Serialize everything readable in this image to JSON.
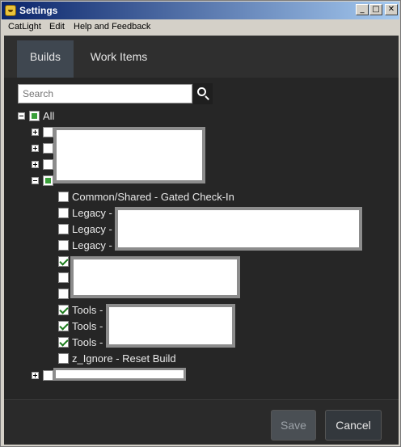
{
  "window": {
    "title": "Settings"
  },
  "menubar": {
    "items": [
      "CatLight",
      "Edit",
      "Help and Feedback"
    ]
  },
  "tabs": [
    {
      "label": "Builds",
      "active": true
    },
    {
      "label": "Work Items",
      "active": false
    }
  ],
  "search": {
    "placeholder": "Search"
  },
  "tree": {
    "root_label": "All",
    "items": [
      "Common/Shared - Gated Check-In",
      "Legacy -",
      "Legacy -",
      "Legacy -",
      "Tools -",
      "Tools -",
      "Tools -",
      "z_Ignore - Reset Build"
    ]
  },
  "footer": {
    "save_label": "Save",
    "cancel_label": "Cancel"
  },
  "colors": {
    "accent_green": "#3aa03a",
    "content_bg": "#262626",
    "active_tab_bg": "#3f4750"
  }
}
